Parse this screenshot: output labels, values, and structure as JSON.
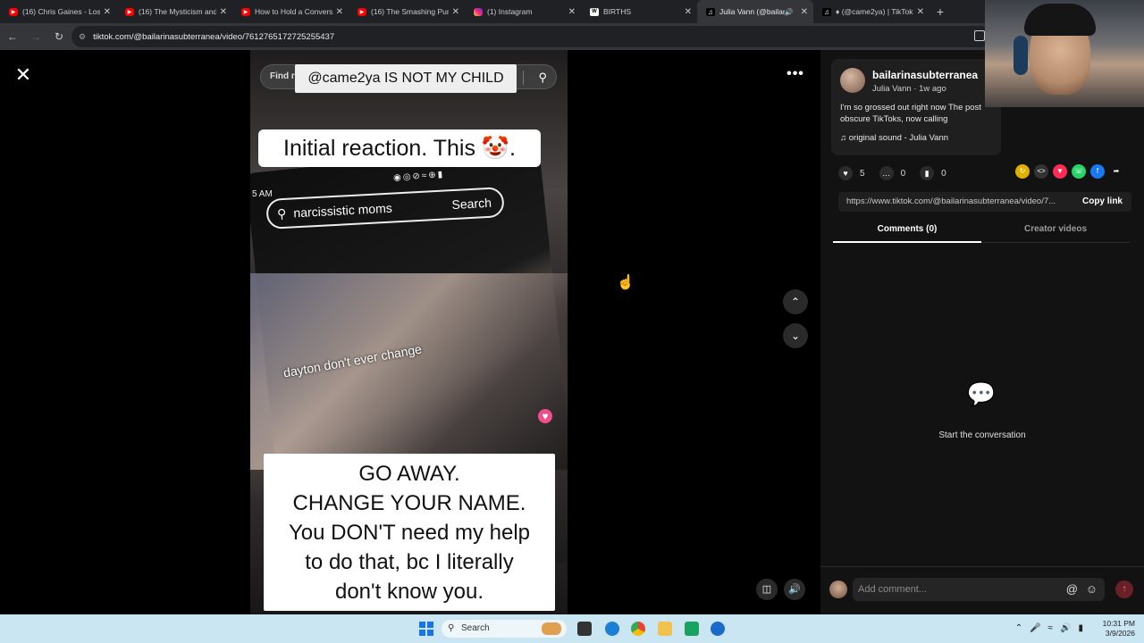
{
  "browser": {
    "tabs": [
      {
        "title": "(16) Chris Gaines - Lost",
        "icon": "youtube-icon"
      },
      {
        "title": "(16) The Mysticism and",
        "icon": "youtube-icon"
      },
      {
        "title": "How to Hold a Convers",
        "icon": "youtube-icon"
      },
      {
        "title": "(16) The Smashing Pum",
        "icon": "youtube-icon"
      },
      {
        "title": "(1) Instagram",
        "icon": "instagram-icon"
      },
      {
        "title": "BIRTHS",
        "icon": "wikipedia-icon"
      },
      {
        "title": "Julia Vann (@bailar",
        "icon": "tiktok-icon",
        "active": true
      },
      {
        "title": "♦ (@came2ya) | TikTok",
        "icon": "tiktok-icon"
      }
    ],
    "url": "tiktok.com/@bailarinasubterranea/video/7612765172725255437"
  },
  "video": {
    "search_placeholder": "Find related content",
    "caption_top": "@came2ya IS NOT MY CHILD",
    "caption_reaction": "Initial reaction. This 🤡.",
    "inner_search_text": "narcissistic moms",
    "inner_search_button": "Search",
    "inner_time": "5 AM",
    "overlay_text": "dayton don't ever change",
    "caption_big_lines": [
      "GO AWAY.",
      "CHANGE YOUR NAME.",
      "You DON'T need my help",
      "to do that, bc I literally",
      "don't know you."
    ]
  },
  "post": {
    "author": "bailarinasubterranea",
    "meta": "Julia Vann · 1w ago",
    "description": "I'm so grossed out right now The post obscure TikToks, now calling",
    "sound": "original sound - Julia Vann",
    "likes": "5",
    "comments": "0",
    "saves": "0",
    "link": "https://www.tiktok.com/@bailarinasubterranea/video/7...",
    "copy_link": "Copy link"
  },
  "panel_tabs": {
    "comments": "Comments (0)",
    "creator_videos": "Creator videos"
  },
  "empty_state": "Start the conversation",
  "comment_input": {
    "placeholder": "Add comment..."
  },
  "taskbar": {
    "search": "Search",
    "time": "10:31 PM",
    "date": "3/9/2026"
  },
  "colors": {
    "tiktok_red": "#fe2c55",
    "panel_bg": "#121212",
    "taskbar_bg": "#c9e6f2"
  }
}
